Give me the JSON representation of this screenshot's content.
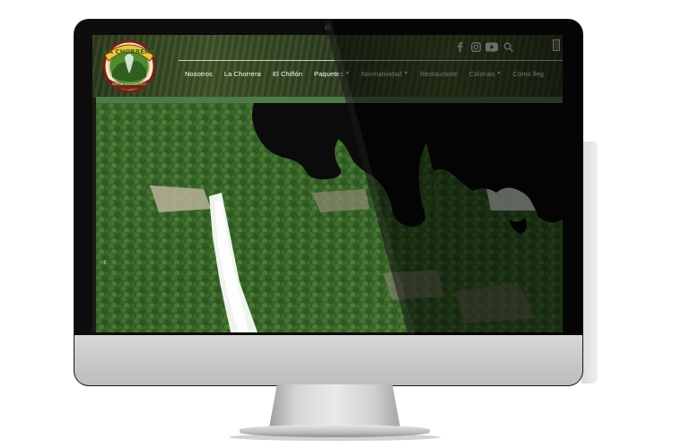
{
  "site": {
    "logo_text_top": "LA CHORRERA",
    "logo_text_bottom": "PARQUE ECOTURISTICO"
  },
  "social": {
    "icons": [
      "facebook-icon",
      "instagram-icon",
      "youtube-icon",
      "search-icon"
    ]
  },
  "nav": {
    "items": [
      {
        "label": "Nosotros",
        "dropdown": false
      },
      {
        "label": "La Chorrera",
        "dropdown": false
      },
      {
        "label": "El Chiflón",
        "dropdown": false
      },
      {
        "label": "Paquetes",
        "dropdown": true
      },
      {
        "label": "Normatividad",
        "dropdown": true
      },
      {
        "label": "Restaurante",
        "dropdown": false
      },
      {
        "label": "Colorias",
        "dropdown": true
      },
      {
        "label": "Como lleg",
        "dropdown": false
      }
    ]
  },
  "colors": {
    "accent_green": "#4f7a4c",
    "header_bg": "#2f3f20"
  }
}
